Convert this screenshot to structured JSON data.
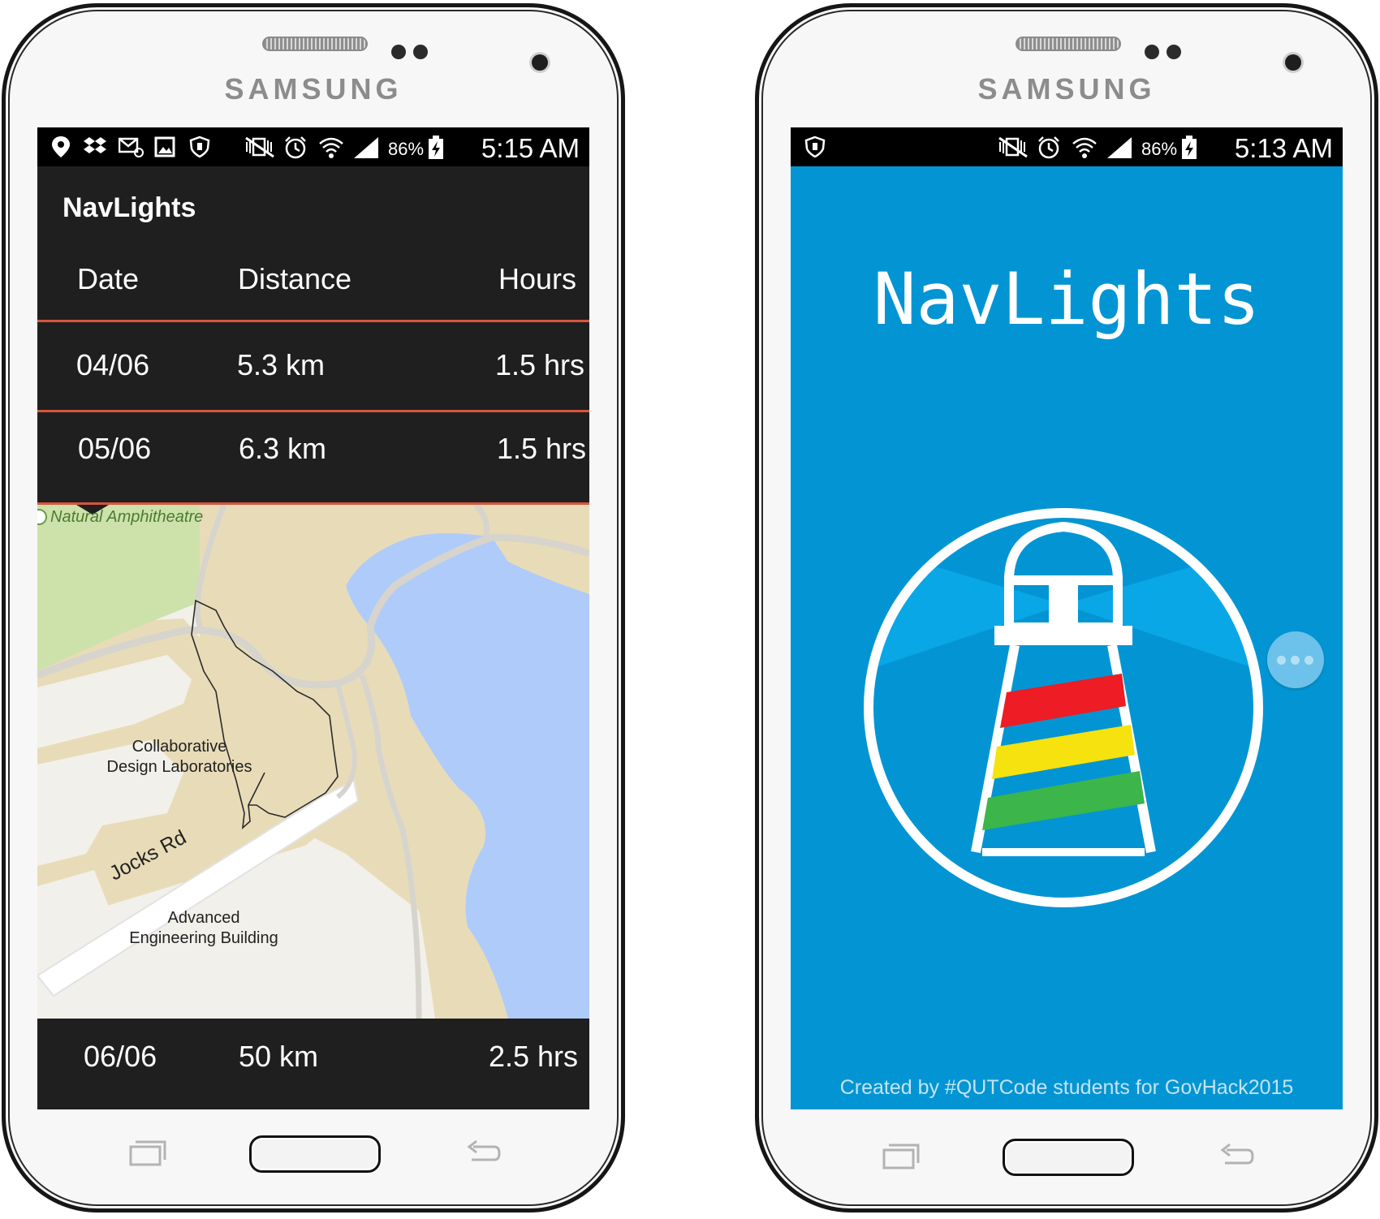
{
  "left_phone": {
    "brand": "SAMSUNG",
    "status_bar": {
      "battery_percent": "86%",
      "time": "5:15 AM"
    },
    "app_title": "NavLights",
    "table": {
      "headers": [
        "Date",
        "Distance",
        "Hours"
      ],
      "rows": [
        {
          "date": "04/06",
          "distance": "5.3 km",
          "hours": "1.5 hrs"
        },
        {
          "date": "05/06",
          "distance": "6.3 km",
          "hours": "1.5 hrs"
        },
        {
          "date": "06/06",
          "distance": "50 km",
          "hours": "2.5 hrs"
        }
      ]
    },
    "map": {
      "labels": {
        "amphitheatre": "Natural Amphitheatre",
        "collab_line1": "Collaborative",
        "collab_line2": "Design Laboratories",
        "road": "Jocks Rd",
        "aeb_line1": "Advanced",
        "aeb_line2": "Engineering Building"
      }
    }
  },
  "right_phone": {
    "brand": "SAMSUNG",
    "status_bar": {
      "battery_percent": "86%",
      "time": "5:13 AM"
    },
    "splash_title": "NavLights",
    "footer": "Created by #QUTCode students for GovHack2015",
    "logo_stripe_colors": [
      "#ee1c24",
      "#f5e20f",
      "#3cb54a"
    ]
  },
  "colors": {
    "dark_bg": "#1f1f1f",
    "divider": "#d9553c",
    "splash_blue": "#0395d3",
    "water": "#aecbfa",
    "park": "#cde2ab",
    "land": "#e8dcb8"
  }
}
